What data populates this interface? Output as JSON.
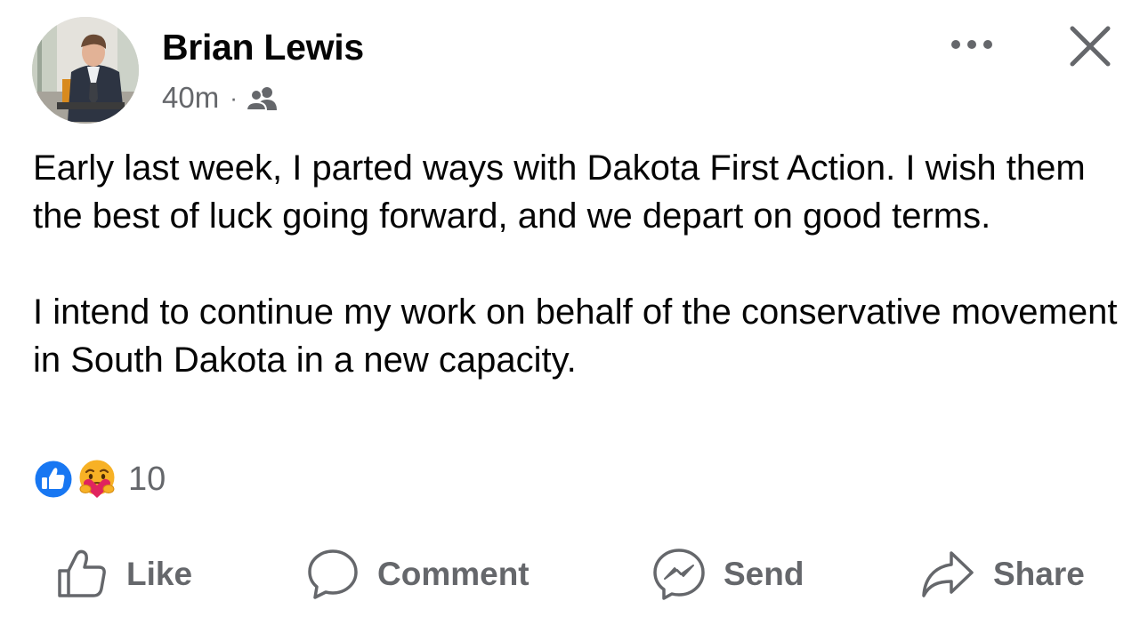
{
  "post": {
    "author": "Brian Lewis",
    "timestamp": "40m",
    "separator": "·",
    "audience_icon": "friends-audience-icon",
    "paragraphs": [
      "Early last week, I parted ways with Dakota First Action. I wish them the best of luck going forward, and we depart on good terms.",
      "I intend to continue my work on behalf of the conservative movement in South Dakota in a new capacity."
    ],
    "reactions": {
      "icons": [
        "like-reaction-icon",
        "care-reaction-icon"
      ],
      "count": "10"
    }
  },
  "header_actions": {
    "more_icon": "more-options-icon",
    "close_icon": "close-icon"
  },
  "actions": {
    "like": "Like",
    "comment": "Comment",
    "send": "Send",
    "share": "Share"
  },
  "colors": {
    "text": "#050505",
    "secondary": "#65676b",
    "like_blue": "#1877f2",
    "care_yellow": "#f7b125",
    "care_red": "#e0245e"
  }
}
